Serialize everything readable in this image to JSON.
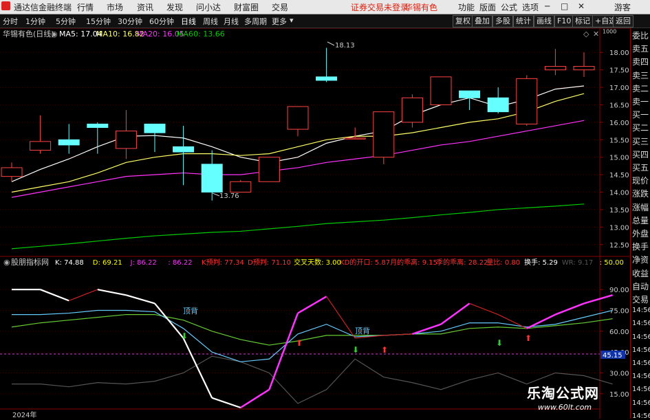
{
  "menubar": {
    "app_title": "通达信金融终端",
    "menus": [
      "行情",
      "市场",
      "资讯",
      "发现",
      "问小达",
      "财富圈",
      "交易"
    ],
    "status_text": "证券交易未登录",
    "stock_name": "华锡有色",
    "right_menus": [
      "功能",
      "版面",
      "公式",
      "选项"
    ],
    "guest": "游客"
  },
  "toolbar": {
    "periods": [
      "分时",
      "1分钟",
      "5分钟",
      "15分钟",
      "30分钟",
      "60分钟",
      "日线",
      "周线",
      "月线",
      "多周期",
      "更多"
    ],
    "active_period": "日线",
    "right_buttons": [
      "复权",
      "叠加",
      "多股",
      "统计",
      "画线",
      "F10",
      "标记",
      "+自选",
      "返回"
    ]
  },
  "main_legend": {
    "title": "华锡有色(日线)",
    "ma5": "MA5: 17.04",
    "ma10": "MA10: 16.82",
    "ma20": "MA20: 16.05",
    "ma60": "MA60: 13.66",
    "colors": {
      "ma5": "#ffffff",
      "ma10": "#ffff66",
      "ma20": "#ff33ff",
      "ma60": "#00cc00"
    }
  },
  "indicator_legend": {
    "title": "股朋指标网",
    "items": [
      {
        "text": "K: 74.88",
        "color": "#ffffff"
      },
      {
        "text": "D: 69.21",
        "color": "#ffff00"
      },
      {
        "text": "J: 86.22",
        "color": "#ff33ff"
      },
      {
        "text": ": 86.22",
        "color": "#ff33ff"
      },
      {
        "text": "K预判: 77.34",
        "color": "#ff3333"
      },
      {
        "text": "D预判: 71.10",
        "color": "#ff3333"
      },
      {
        "text": "交叉天数: 3.00",
        "color": "#ffff00"
      },
      {
        "text": "KD的开口: 5.87",
        "color": "#ff3333"
      },
      {
        "text": "月的乖离: 9.15",
        "color": "#ff3333"
      },
      {
        "text": "季的乖离: 28.22",
        "color": "#ff3333"
      },
      {
        "text": "量比: 0.80",
        "color": "#ff3333"
      },
      {
        "text": "换手: 5.29",
        "color": "#ffffff"
      },
      {
        "text": "WR: 9.17",
        "color": "#555555"
      },
      {
        "text": ": 50.00",
        "color": "#ffff00"
      }
    ]
  },
  "price_axis": {
    "ticks": [
      "18.00",
      "17.50",
      "17.00",
      "16.50",
      "16.00",
      "15.50",
      "15.00",
      "14.50",
      "14.00",
      "13.50",
      "13.00",
      "12.50"
    ],
    "unit_label": "1000"
  },
  "annotations": {
    "high": "18.13",
    "low": "13.76",
    "top_sig": "顶背",
    "top_sig2": "顶背",
    "current_value": "45.15",
    "year": "2024年"
  },
  "ind_axis": {
    "ticks": [
      "90.00",
      "75.00",
      "60.00",
      "45.00",
      "30.00",
      "15.00"
    ]
  },
  "side_panel": [
    "委比",
    "卖五",
    "卖四",
    "卖三",
    "卖二",
    "卖一",
    "买一",
    "买二",
    "买三",
    "买四",
    "买五",
    "现价",
    "涨跌",
    "涨幅",
    "总量",
    "外盘",
    "换手",
    "净资",
    "收益",
    "自动",
    "交易",
    "14:56",
    "14:56",
    "14:56",
    "14:56",
    "14:56",
    "14:56",
    "14:56",
    "14:56",
    "14:56"
  ],
  "watermark": {
    "line1": "乐淘公式网",
    "line2": "www.60lt.com"
  },
  "chart_data": [
    {
      "type": "candlestick",
      "title": "华锡有色(日线)",
      "ylim": [
        12.2,
        18.3
      ],
      "candles": [
        {
          "o": 14.45,
          "c": 14.7,
          "h": 14.85,
          "l": 14.3
        },
        {
          "o": 15.2,
          "c": 15.45,
          "h": 16.2,
          "l": 15.1
        },
        {
          "o": 15.5,
          "c": 15.35,
          "h": 15.95,
          "l": 15.1
        },
        {
          "o": 15.95,
          "c": 15.85,
          "h": 16.0,
          "l": 15.1
        },
        {
          "o": 15.25,
          "c": 15.75,
          "h": 16.35,
          "l": 14.95
        },
        {
          "o": 15.95,
          "c": 15.7,
          "h": 15.95,
          "l": 15.15
        },
        {
          "o": 15.3,
          "c": 15.15,
          "h": 15.9,
          "l": 14.2
        },
        {
          "o": 14.8,
          "c": 14.0,
          "h": 15.2,
          "l": 13.76
        },
        {
          "o": 14.0,
          "c": 14.3,
          "h": 14.35,
          "l": 14.0
        },
        {
          "o": 14.3,
          "c": 15.0,
          "h": 15.0,
          "l": 14.3
        },
        {
          "o": 15.8,
          "c": 16.45,
          "h": 16.45,
          "l": 15.6
        },
        {
          "o": 17.3,
          "c": 17.2,
          "h": 18.13,
          "l": 17.15
        },
        {
          "o": 15.55,
          "c": 15.55,
          "h": 15.85,
          "l": 15.55
        },
        {
          "o": 15.0,
          "c": 16.3,
          "h": 16.3,
          "l": 14.8
        },
        {
          "o": 16.0,
          "c": 16.7,
          "h": 16.8,
          "l": 15.85
        },
        {
          "o": 16.5,
          "c": 17.3,
          "h": 17.3,
          "l": 16.5
        },
        {
          "o": 16.9,
          "c": 16.7,
          "h": 16.9,
          "l": 16.35
        },
        {
          "o": 16.7,
          "c": 16.3,
          "h": 17.0,
          "l": 16.25
        },
        {
          "o": 15.95,
          "c": 17.25,
          "h": 17.35,
          "l": 15.9
        },
        {
          "o": 17.5,
          "c": 17.6,
          "h": 18.1,
          "l": 17.35
        },
        {
          "o": 17.5,
          "c": 17.6,
          "h": 18.0,
          "l": 17.3
        }
      ],
      "series": [
        {
          "name": "MA5",
          "color": "#ffffff",
          "values": [
            14.3,
            14.65,
            14.95,
            15.3,
            15.6,
            15.62,
            15.55,
            15.3,
            15.0,
            14.85,
            15.0,
            15.4,
            15.6,
            15.75,
            16.2,
            16.5,
            16.7,
            16.45,
            16.65,
            16.95,
            17.04
          ]
        },
        {
          "name": "MA10",
          "color": "#ffff66",
          "values": [
            14.0,
            14.15,
            14.3,
            14.55,
            14.85,
            15.0,
            15.1,
            15.1,
            15.05,
            15.1,
            15.3,
            15.5,
            15.6,
            15.6,
            15.7,
            15.85,
            16.0,
            16.1,
            16.3,
            16.6,
            16.82
          ]
        },
        {
          "name": "MA20",
          "color": "#ff33ff",
          "values": [
            13.85,
            14.0,
            14.15,
            14.3,
            14.45,
            14.5,
            14.55,
            14.5,
            14.5,
            14.6,
            14.7,
            14.85,
            14.95,
            15.05,
            15.2,
            15.35,
            15.45,
            15.6,
            15.75,
            15.9,
            16.05
          ]
        },
        {
          "name": "MA60",
          "color": "#00cc00",
          "values": [
            12.38,
            12.45,
            12.52,
            12.6,
            12.68,
            12.75,
            12.8,
            12.85,
            12.88,
            12.95,
            13.02,
            13.1,
            13.15,
            13.2,
            13.27,
            13.35,
            13.42,
            13.5,
            13.55,
            13.6,
            13.66
          ]
        }
      ]
    },
    {
      "type": "line",
      "title": "股朋指标网",
      "ylim": [
        5,
        100
      ],
      "series": [
        {
          "name": "K",
          "color": "#ffffff",
          "values": [
            90,
            90,
            82,
            90,
            86,
            80,
            55,
            12,
            5,
            18,
            73,
            85,
            55,
            57,
            58,
            65,
            80,
            72,
            62,
            72,
            80,
            86
          ]
        },
        {
          "name": "J",
          "color": "#ff33ff",
          "values": [
            90,
            90,
            82,
            90,
            86,
            80,
            55,
            12,
            5,
            18,
            73,
            85,
            55,
            57,
            58,
            65,
            80,
            72,
            62,
            72,
            80,
            86
          ]
        },
        {
          "name": "D",
          "color": "#66ccff",
          "values": [
            72,
            72,
            73,
            75,
            75,
            74,
            62,
            45,
            38,
            40,
            58,
            65,
            56,
            57,
            58,
            60,
            66,
            66,
            63,
            65,
            70,
            75
          ]
        },
        {
          "name": "L3",
          "color": "#66cc33",
          "values": [
            63,
            66,
            68,
            70,
            72,
            72,
            68,
            60,
            54,
            50,
            53,
            57,
            57,
            57,
            58,
            58,
            62,
            63,
            62,
            64,
            66,
            69
          ]
        },
        {
          "name": "L4",
          "color": "#555555",
          "values": [
            22,
            22,
            20,
            23,
            22,
            24,
            30,
            42,
            38,
            30,
            8,
            18,
            40,
            27,
            23,
            18,
            25,
            30,
            22,
            30,
            28,
            22
          ]
        }
      ]
    }
  ]
}
